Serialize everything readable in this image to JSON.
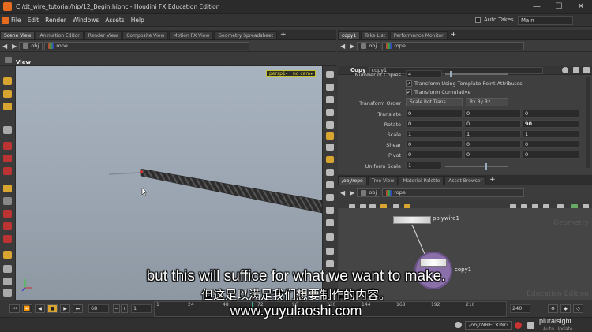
{
  "window": {
    "title": "C:/dt_wire_tutorial/hip/12_Begin.hipnc - Houdini FX Education Edition",
    "controls": [
      "—",
      "☐",
      "✕"
    ]
  },
  "menubar": {
    "items": [
      "File",
      "Edit",
      "Render",
      "Windows",
      "Assets",
      "Help"
    ],
    "auto_takes_label": "Auto Takes",
    "desktop": "Main"
  },
  "left_pane": {
    "tabs": [
      "Scene View",
      "Animation Editor",
      "Render View",
      "Composite View",
      "Motion FX View",
      "Geometry Spreadsheet"
    ],
    "path": [
      "obj",
      "rope"
    ],
    "view_label": "View",
    "camera_buttons": [
      "persp1▾",
      "no cam▾"
    ]
  },
  "param_pane": {
    "tabs": [
      "copy1",
      "Take List",
      "Performance Monitor"
    ],
    "path": [
      "obj",
      "rope"
    ],
    "node_type": "Copy",
    "node_name": "copy1",
    "number_of_copies_label": "Number of Copies",
    "number_of_copies": "4",
    "checkbox1": "Transform Using Template Point Attributes",
    "checkbox2": "Transform Cumulative",
    "transform_order_label": "Transform Order",
    "transform_order": "Scale Rot Trans",
    "rot_order": "Rx Ry Rz",
    "translate_label": "Translate",
    "translate": [
      "0",
      "0",
      "0"
    ],
    "rotate_label": "Rotate",
    "rotate": [
      "0",
      "0",
      "90"
    ],
    "scale_label": "Scale",
    "scale": [
      "1",
      "1",
      "1"
    ],
    "shear_label": "Shear",
    "shear": [
      "0",
      "0",
      "0"
    ],
    "pivot_label": "Pivot",
    "pivot": [
      "0",
      "0",
      "0"
    ],
    "uniform_scale_label": "Uniform Scale",
    "uniform_scale": "1"
  },
  "network_pane": {
    "tabs": [
      "/obj/rope",
      "Tree View",
      "Material Palette",
      "Asset Browser"
    ],
    "path": [
      "obj",
      "rope"
    ],
    "node1": "polywire1",
    "node2": "copy1",
    "watermark_top": "Geometry",
    "watermark_bottom": "Education Edition"
  },
  "timeline": {
    "current_frame": "68",
    "start_frame": "1",
    "end_frame": "240",
    "ticks": [
      "1",
      "24",
      "48",
      "72",
      "96",
      "120",
      "144",
      "168",
      "192",
      "216"
    ]
  },
  "statusbar": {
    "path": "/obj/WRECKING",
    "auto_update": "Auto Update"
  },
  "subtitles": {
    "english": "but this will suffice for what we want to make.",
    "chinese": "但这足以满足我们想要制作的内容。",
    "website": "www.yuyulaoshi.com"
  },
  "brand": "pluralsight"
}
